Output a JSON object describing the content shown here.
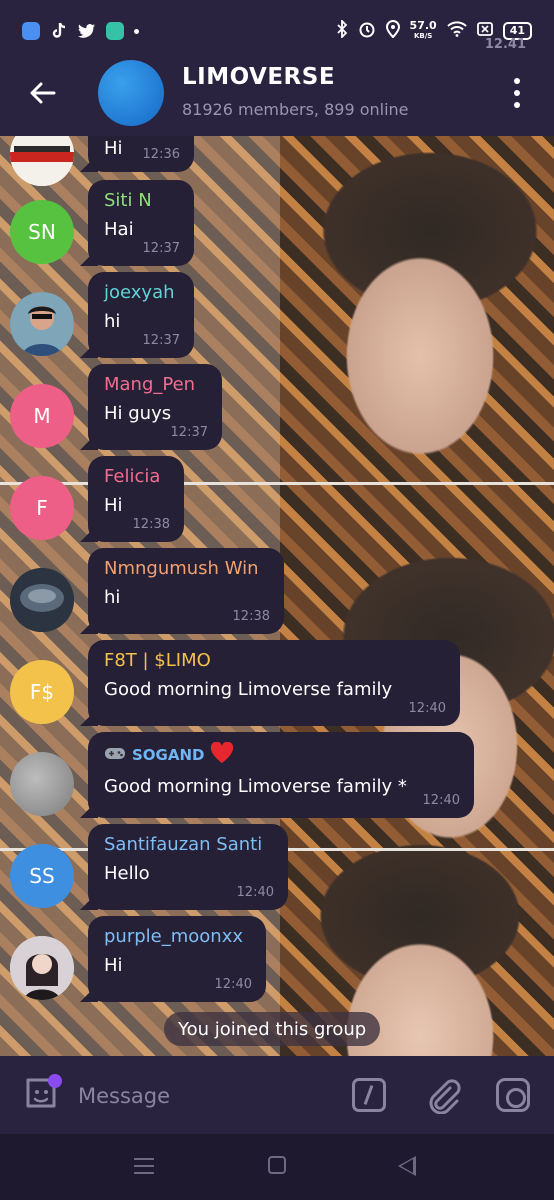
{
  "status_bar": {
    "time": "12.41",
    "net_speed": "57.0",
    "net_unit": "KB/S",
    "battery": "41"
  },
  "header": {
    "title": "LIMOVERSE",
    "subtitle": "81926 members, 899 online"
  },
  "messages": [
    {
      "initials": "",
      "sender": "",
      "text": "Hi",
      "time": "12:36",
      "avatar_color": "#c8261e",
      "sender_color": "#8ee07a"
    },
    {
      "initials": "SN",
      "sender": "Siti N",
      "text": "Hai",
      "time": "12:37",
      "avatar_color": "#56c23f",
      "sender_color": "#8ee07a"
    },
    {
      "initials": "",
      "sender": "joexyah",
      "text": "hi",
      "time": "12:37",
      "avatar_color": "#3b6b8a",
      "sender_color": "#5fd4d8"
    },
    {
      "initials": "M",
      "sender": "Mang_Pen",
      "text": "Hi guys",
      "time": "12:37",
      "avatar_color": "#ee5f87",
      "sender_color": "#f26d8f"
    },
    {
      "initials": "F",
      "sender": "Felicia",
      "text": "Hi",
      "time": "12:38",
      "avatar_color": "#ee5f87",
      "sender_color": "#f26d8f"
    },
    {
      "initials": "",
      "sender": "Nmngumush Win",
      "text": "hi",
      "time": "12:38",
      "avatar_color": "#2b3440",
      "sender_color": "#f3a06e"
    },
    {
      "initials": "F$",
      "sender": "F8T | $LIMO",
      "text": "Good morning Limoverse family",
      "time": "12:40",
      "avatar_color": "#f3c24a",
      "sender_color": "#f3c24a"
    },
    {
      "initials": "",
      "sender": "SOGAND",
      "text": "Good morning Limoverse family *",
      "time": "12:40",
      "avatar_color": "#9a9a9a",
      "sender_color": "#6fb6f5"
    },
    {
      "initials": "SS",
      "sender": "Santifauzan Santi",
      "text": "Hello",
      "time": "12:40",
      "avatar_color": "#3f8fe0",
      "sender_color": "#7fbdf5"
    },
    {
      "initials": "",
      "sender": "purple_moonxx",
      "text": "Hi",
      "time": "12:40",
      "avatar_color": "#c9c2c8",
      "sender_color": "#7fbdf5"
    }
  ],
  "service_message": "You joined this group",
  "input": {
    "placeholder": "Message"
  },
  "colors": {
    "bar_bg": "#2a2340",
    "bubble_bg": "#262036",
    "group_avatar": "#1e86dc",
    "accent": "#8a4cf0"
  }
}
